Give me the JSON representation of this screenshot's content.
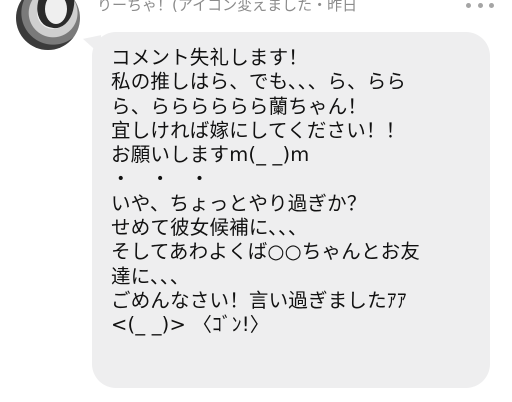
{
  "comment": {
    "header": "りーちゃ！(アイコン変えました・昨日",
    "lines": [
      "コメント失礼します！",
      "私の推しはら、でも、、、ら、らら",
      "ら、らららららら蘭ちゃん！",
      "宜しければ嫁にしてください！！",
      "お願いしますm(_ _)m",
      "・　・　・",
      "いや、ちょっとやり過ぎか？",
      "せめて彼女候補に、、、",
      "そしてあわよくば○○ちゃんとお友",
      "達に、、、",
      "ごめんなさい！言い過ぎましたｱｱ",
      "<(_ _)> 〈ｺﾞﾝ!〉"
    ]
  },
  "icons": {
    "more": "more-dots-icon",
    "avatar": "user-avatar"
  },
  "colors": {
    "bubble_background": "#eeeeef",
    "header_text": "#8c8c8c",
    "message_text": "#111111",
    "more_dots": "#a5a5a5"
  }
}
